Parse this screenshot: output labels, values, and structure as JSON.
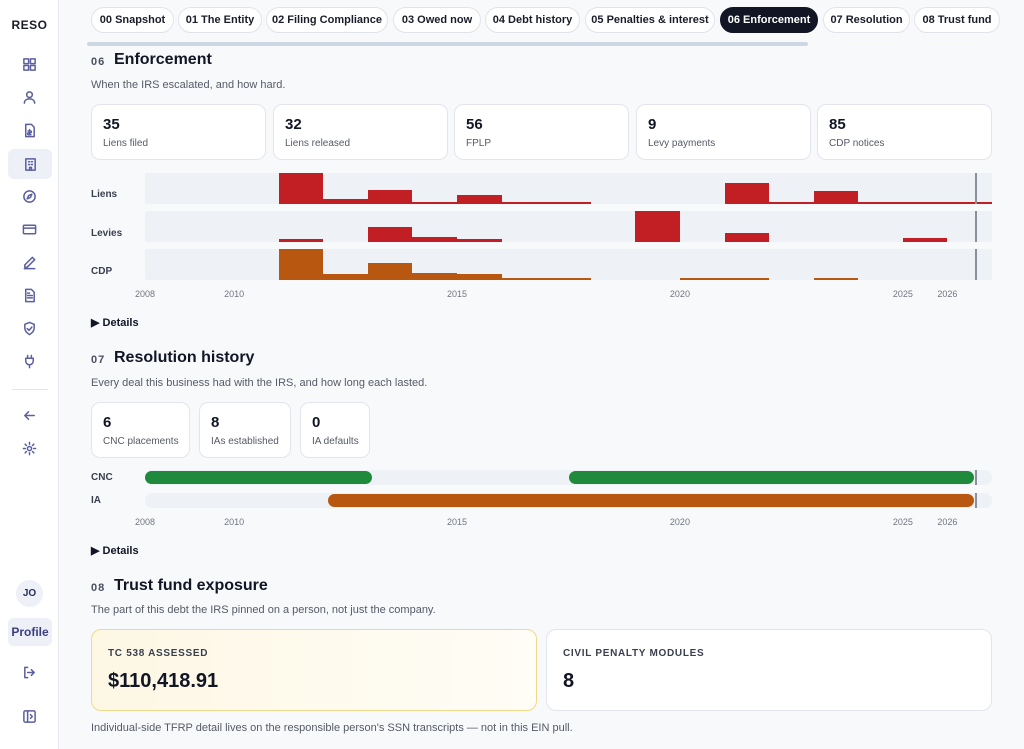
{
  "app": {
    "logo": "RESO"
  },
  "sidebar": {
    "icons": [
      "dashboard-icon",
      "user-icon",
      "document-dollar-icon",
      "building-icon",
      "compass-icon",
      "credit-card-icon",
      "pencil-icon",
      "file-text-icon",
      "shield-check-icon",
      "plug-icon",
      "arrow-left-icon",
      "gear-icon",
      "logout-icon",
      "panel-toggle-icon"
    ],
    "avatar": "JO",
    "profile": "Profile"
  },
  "tabs": [
    "00 Snapshot",
    "01 The Entity",
    "02 Filing Compliance",
    "03 Owed now",
    "04 Debt history",
    "05 Penalties & interest",
    "06 Enforcement",
    "07 Resolution",
    "08 Trust fund"
  ],
  "active_tab": "06 Enforcement",
  "enforcement": {
    "num": "06",
    "title": "Enforcement",
    "subtitle": "When the IRS escalated, and how hard.",
    "stats": [
      {
        "value": "35",
        "label": "Liens filed"
      },
      {
        "value": "32",
        "label": "Liens released"
      },
      {
        "value": "56",
        "label": "FPLP"
      },
      {
        "value": "9",
        "label": "Levy payments"
      },
      {
        "value": "85",
        "label": "CDP notices"
      }
    ],
    "rows": [
      "Liens",
      "Levies",
      "CDP"
    ],
    "details": "▶ Details"
  },
  "resolution": {
    "num": "07",
    "title": "Resolution history",
    "subtitle": "Every deal this business had with the IRS, and how long each lasted.",
    "stats": [
      {
        "value": "6",
        "label": "CNC placements"
      },
      {
        "value": "8",
        "label": "IAs established"
      },
      {
        "value": "0",
        "label": "IA defaults"
      }
    ],
    "rows": [
      "CNC",
      "IA"
    ],
    "details": "▶ Details"
  },
  "trust_fund": {
    "num": "08",
    "title": "Trust fund exposure",
    "subtitle": "The part of this debt the IRS pinned on a person, not just the company.",
    "cards": [
      {
        "label": "TC 538 ASSESSED",
        "value": "$110,418.91"
      },
      {
        "label": "CIVIL PENALTY MODULES",
        "value": "8"
      }
    ],
    "footnote": "Individual-side TFRP detail lives on the responsible person's SSN transcripts — not in this EIN pull."
  },
  "colors": {
    "lien": "#c11f23",
    "levy": "#c11f23",
    "cdp": "#b8570f",
    "cnc": "#1f8a3b",
    "ia": "#b8570f",
    "track": "#eef1f5"
  },
  "chart_data": [
    {
      "type": "bar",
      "title": "",
      "x_ticks": [
        2008,
        2010,
        2015,
        2020,
        2025,
        2026
      ],
      "xlim": [
        2008,
        2027
      ],
      "now_marker": 2026.65,
      "series": [
        {
          "name": "Liens",
          "bars": [
            [
              2011,
              2012,
              1.0
            ],
            [
              2012,
              2013,
              0.15
            ],
            [
              2013,
              2014,
              0.45
            ],
            [
              2014,
              2015,
              0.08
            ],
            [
              2015,
              2016,
              0.28
            ],
            [
              2016,
              2017,
              0.08
            ],
            [
              2017,
              2018,
              0.08
            ],
            [
              2021,
              2022,
              0.68
            ],
            [
              2022,
              2023,
              0.05
            ],
            [
              2023,
              2024,
              0.42
            ],
            [
              2024,
              2025,
              0.08
            ],
            [
              2025,
              2026,
              0.08
            ],
            [
              2026,
              2027,
              0.08
            ]
          ]
        },
        {
          "name": "Levies",
          "bars": [
            [
              2011,
              2012,
              0.1
            ],
            [
              2013,
              2014,
              0.5
            ],
            [
              2014,
              2015,
              0.15
            ],
            [
              2015,
              2016,
              0.1
            ],
            [
              2019,
              2020,
              1.0
            ],
            [
              2021,
              2022,
              0.28
            ],
            [
              2025,
              2026,
              0.12
            ]
          ]
        },
        {
          "name": "CDP",
          "bars": [
            [
              2011,
              2012,
              1.0
            ],
            [
              2012,
              2013,
              0.18
            ],
            [
              2013,
              2014,
              0.55
            ],
            [
              2014,
              2015,
              0.22
            ],
            [
              2015,
              2016,
              0.18
            ],
            [
              2016,
              2017,
              0.08
            ],
            [
              2017,
              2018,
              0.05
            ],
            [
              2020,
              2021,
              0.08
            ],
            [
              2021,
              2022,
              0.08
            ],
            [
              2023,
              2024,
              0.08
            ]
          ]
        }
      ]
    },
    {
      "type": "bar",
      "title": "",
      "x_ticks": [
        2008,
        2010,
        2015,
        2020,
        2025,
        2026
      ],
      "xlim": [
        2008,
        2027
      ],
      "now_marker": 2026.65,
      "series": [
        {
          "name": "CNC",
          "spans": [
            [
              2008,
              2013.1
            ],
            [
              2017.5,
              2026.6
            ]
          ]
        },
        {
          "name": "IA",
          "spans": [
            [
              2012.1,
              2026.6
            ]
          ]
        }
      ]
    }
  ]
}
